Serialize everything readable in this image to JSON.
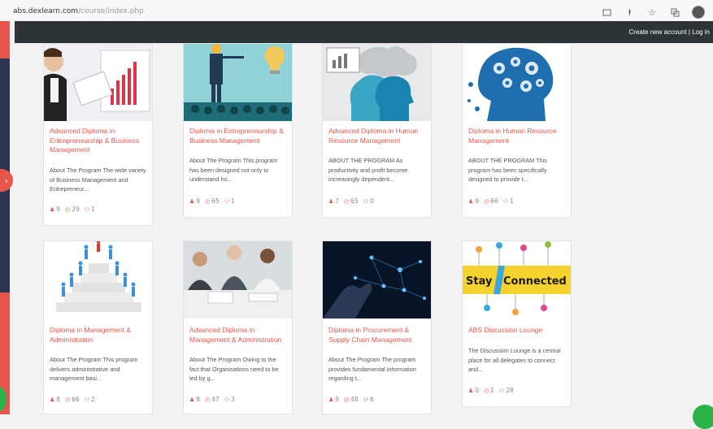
{
  "browser": {
    "url_host": "abs.dexlearn.com",
    "url_path": "/course/index.php",
    "icons": [
      "tab-icon",
      "extension-icon",
      "bookmark-star-icon",
      "translate-icon",
      "profile-avatar"
    ]
  },
  "header": {
    "create_account": "Create new account",
    "separator": "|",
    "login": "Log in"
  },
  "sidebar": {
    "toggle_glyph": "›"
  },
  "colors": {
    "accent": "#e8554b",
    "topbar": "#2d3437",
    "sidebar": "#2b3451",
    "stat_icon": "#e8554b"
  },
  "courses": [
    {
      "title": "Advanced Diploma in Entrepreneurship & Business Management",
      "desc": "About The Program The wide variety of Business Management and Entrepreneur...",
      "learners": "9",
      "views": "29",
      "groups": "1"
    },
    {
      "title": "Diploma in Entrepreneurship & Business Management",
      "desc": "About The Program This program has been designed not only to understand ho...",
      "learners": "9",
      "views": "65",
      "groups": "1"
    },
    {
      "title": "Advanced Diploma in Human Resource Management",
      "desc": "ABOUT THE PROGRAM As productivity and profit become increasingly dependent...",
      "learners": "7",
      "views": "65",
      "groups": "0"
    },
    {
      "title": "Diploma in Human Resource Management",
      "desc": "ABOUT THE PROGRAM This program has been specifically designed to provide t...",
      "learners": "9",
      "views": "66",
      "groups": "1"
    },
    {
      "title": "Diploma in Management & Administration",
      "desc": "About The Program This program delivers administrative and management basi...",
      "learners": "8",
      "views": "66",
      "groups": "2"
    },
    {
      "title": "Advanced Diploma in Management & Administration",
      "desc": "About The Program Owing to the fact that Organisations need to be led by g...",
      "learners": "8",
      "views": "47",
      "groups": "3"
    },
    {
      "title": "Diploma in Procurement & Supply Chain Management",
      "desc": "About The Program The program provides fundamental information regarding t...",
      "learners": "9",
      "views": "48",
      "groups": "6"
    },
    {
      "title": "ABS Discussion Lounge",
      "desc": "The Discussion Lounge is a central place for all delegates to connect and...",
      "learners": "0",
      "views": "1",
      "groups": "28"
    }
  ],
  "lounge_banner": {
    "word1": "Stay",
    "word2": "Connected"
  }
}
